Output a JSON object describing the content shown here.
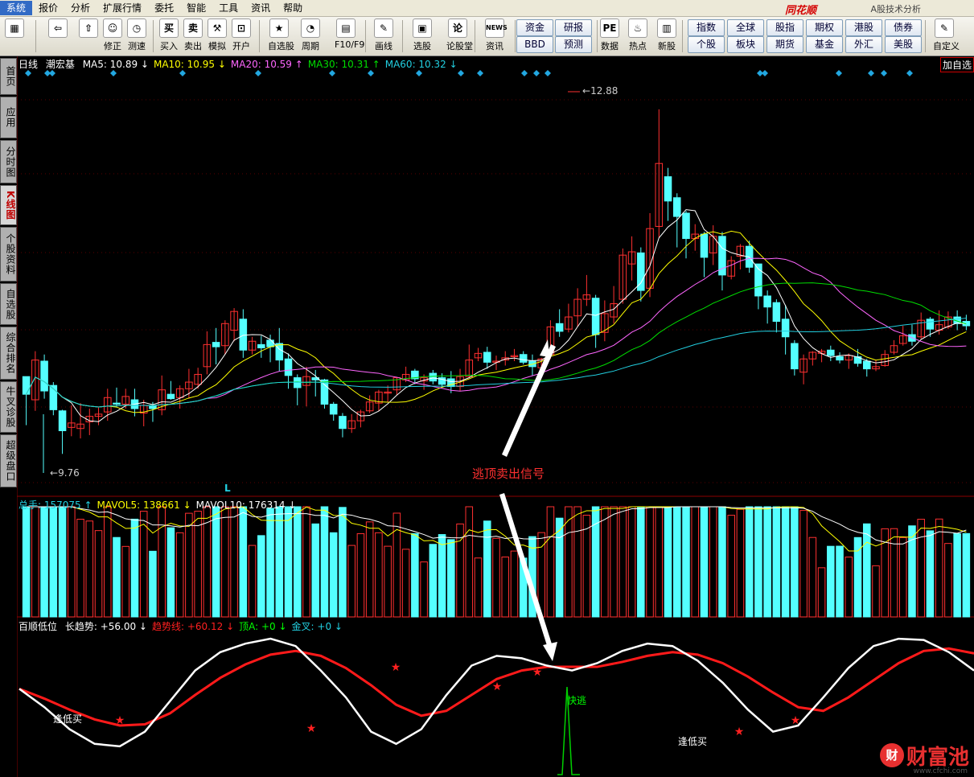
{
  "menu": [
    "系统",
    "报价",
    "分析",
    "扩展行情",
    "委托",
    "智能",
    "工具",
    "资讯",
    "帮助"
  ],
  "brand": {
    "name": "同花顺",
    "subtitle": "A股技术分析"
  },
  "toolbar": {
    "buttons": [
      {
        "label": "",
        "icon": "layout-icon",
        "glyph": "▦"
      },
      {
        "label": "",
        "icon": "back-icon",
        "glyph": "⇦"
      },
      {
        "label": "",
        "icon": "up-down-icon",
        "glyph": "⇧"
      },
      {
        "label": "修正",
        "icon": "adjust-icon",
        "glyph": "☺"
      },
      {
        "label": "测速",
        "icon": "speed-icon",
        "glyph": "◷"
      },
      {
        "label": "买入",
        "icon": "buy-icon",
        "glyph": "买"
      },
      {
        "label": "卖出",
        "icon": "sell-icon",
        "glyph": "卖"
      },
      {
        "label": "模拟",
        "icon": "hammer-icon",
        "glyph": "⚒"
      },
      {
        "label": "开户",
        "icon": "lock-icon",
        "glyph": "⊡"
      },
      {
        "label": "自选股",
        "icon": "star-icon",
        "glyph": "★"
      },
      {
        "label": "周期",
        "icon": "clock-icon",
        "glyph": "◔"
      },
      {
        "label": "F10/F9",
        "icon": "f10-icon",
        "glyph": "▤"
      },
      {
        "label": "画线",
        "icon": "pen-icon",
        "glyph": "✎"
      },
      {
        "label": "选股",
        "icon": "monitor-icon",
        "glyph": "▣"
      },
      {
        "label": "论股堂",
        "icon": "forum-icon",
        "glyph": "论"
      },
      {
        "label": "资讯",
        "icon": "news-icon",
        "glyph": "NEWS"
      },
      {
        "label": "数据",
        "icon": "pe-icon",
        "glyph": "PE"
      },
      {
        "label": "热点",
        "icon": "hot-icon",
        "glyph": "♨"
      },
      {
        "label": "新股",
        "icon": "newstock-icon",
        "glyph": "▥"
      },
      {
        "label": "自定义",
        "icon": "custom-icon",
        "glyph": "✎"
      }
    ],
    "grid_buttons": [
      [
        "资金",
        "研报"
      ],
      [
        "BBD",
        "预测"
      ],
      [
        "指数",
        "全球",
        "股指",
        "期权",
        "港股",
        "债券"
      ],
      [
        "个股",
        "板块",
        "期货",
        "基金",
        "外汇",
        "美股"
      ]
    ]
  },
  "sidebar_tabs": [
    "首页",
    "应用",
    "分时图",
    "K线图",
    "个股资料",
    "自选股",
    "综合排名",
    "牛叉诊股",
    "超级盘口"
  ],
  "sidebar_active": "K线图",
  "price_panel": {
    "period": "日线",
    "stock": "潮宏基",
    "ma": [
      {
        "name": "MA5",
        "value": "10.89",
        "dir": "↓",
        "color": "#ffffff"
      },
      {
        "name": "MA10",
        "value": "10.95",
        "dir": "↓",
        "color": "#ffff00"
      },
      {
        "name": "MA20",
        "value": "10.59",
        "dir": "↑",
        "color": "#ff66ff"
      },
      {
        "name": "MA30",
        "value": "10.31",
        "dir": "↑",
        "color": "#00dd00"
      },
      {
        "name": "MA60",
        "value": "10.32",
        "dir": "↓",
        "color": "#22cfe0"
      }
    ],
    "high_label": "12.88",
    "low_label": "9.76",
    "marker_L": "L",
    "add_button": "加自选"
  },
  "annotation": "逃顶卖出信号",
  "volume_panel": {
    "items": [
      {
        "name": "总手",
        "value": "157075",
        "dir": "↑",
        "color": "#22cfe0"
      },
      {
        "name": "MAVOL5",
        "value": "138661",
        "dir": "↓",
        "color": "#ffff00"
      },
      {
        "name": "MAVOL10",
        "value": "176314",
        "dir": "↓",
        "color": "#ffffff"
      }
    ]
  },
  "indicator_panel": {
    "title": "百顺低位",
    "items": [
      {
        "name": "长趋势",
        "value": "+56.00",
        "dir": "↓",
        "color": "#ffffff"
      },
      {
        "name": "趋势线",
        "value": "+60.12",
        "dir": "↓",
        "color": "#ff2020"
      },
      {
        "name": "顶A",
        "value": "+0",
        "dir": "↓",
        "color": "#00ff00"
      },
      {
        "name": "金叉",
        "value": "+0",
        "dir": "↓",
        "color": "#22cfe0"
      }
    ],
    "labels": [
      "逢低买",
      "快逃",
      "逢低买"
    ]
  },
  "watermark": {
    "logo": "财",
    "text": "财富池",
    "url": "www.cfchi.com"
  },
  "chart_data": {
    "type": "candlestick",
    "price_range": [
      9.5,
      13.2
    ],
    "high": 12.88,
    "low": 9.76,
    "candles": [
      [
        10.46,
        10.3,
        10.46,
        10.02
      ],
      [
        10.25,
        10.61,
        10.69,
        10.15
      ],
      [
        10.6,
        10.33,
        10.66,
        10.26
      ],
      [
        10.38,
        10.16,
        10.41,
        10.11
      ],
      [
        10.15,
        9.97,
        10.16,
        9.76
      ],
      [
        10.0,
        10.04,
        10.2,
        9.92
      ],
      [
        9.99,
        10.03,
        10.22,
        9.9
      ],
      [
        10.05,
        10.1,
        10.17,
        9.93
      ],
      [
        10.1,
        10.12,
        10.18,
        10.02
      ],
      [
        10.14,
        10.27,
        10.35,
        10.06
      ],
      [
        10.22,
        10.21,
        10.36,
        10.18
      ],
      [
        10.21,
        10.28,
        10.35,
        10.17
      ],
      [
        10.25,
        10.17,
        10.35,
        10.1
      ],
      [
        10.13,
        10.2,
        10.25,
        10.01
      ],
      [
        10.2,
        10.17,
        10.23,
        10.05
      ],
      [
        10.16,
        10.34,
        10.47,
        10.11
      ],
      [
        10.3,
        10.26,
        10.42,
        10.25
      ],
      [
        10.27,
        10.35,
        10.38,
        10.17
      ],
      [
        10.35,
        10.41,
        10.53,
        10.26
      ],
      [
        10.39,
        10.48,
        10.54,
        10.35
      ],
      [
        10.55,
        10.75,
        10.87,
        10.48
      ],
      [
        10.77,
        10.73,
        10.9,
        10.57
      ],
      [
        10.74,
        10.94,
        10.97,
        10.66
      ],
      [
        10.88,
        11.05,
        11.08,
        10.78
      ],
      [
        10.98,
        10.7,
        11.07,
        10.63
      ],
      [
        10.7,
        10.78,
        10.82,
        10.66
      ],
      [
        10.75,
        10.72,
        10.83,
        10.63
      ],
      [
        10.79,
        10.73,
        10.84,
        10.59
      ],
      [
        10.76,
        10.61,
        10.9,
        10.51
      ],
      [
        10.62,
        10.47,
        10.67,
        10.35
      ],
      [
        10.45,
        10.36,
        10.48,
        10.2
      ],
      [
        10.38,
        10.46,
        10.55,
        10.19
      ],
      [
        10.45,
        10.43,
        10.52,
        10.28
      ],
      [
        10.43,
        10.21,
        10.44,
        10.17
      ],
      [
        10.21,
        10.12,
        10.23,
        10.06
      ],
      [
        10.1,
        9.99,
        10.13,
        9.91
      ],
      [
        9.99,
        10.06,
        10.12,
        9.95
      ],
      [
        10.06,
        10.14,
        10.16,
        10.0
      ],
      [
        10.15,
        10.23,
        10.29,
        10.13
      ],
      [
        10.22,
        10.32,
        10.34,
        10.15
      ],
      [
        10.31,
        10.32,
        10.38,
        10.23
      ],
      [
        10.34,
        10.45,
        10.45,
        10.29
      ],
      [
        10.43,
        10.48,
        10.55,
        10.41
      ],
      [
        10.51,
        10.44,
        10.53,
        10.39
      ],
      [
        10.42,
        10.45,
        10.48,
        10.34
      ],
      [
        10.49,
        10.42,
        10.52,
        10.39
      ],
      [
        10.45,
        10.39,
        10.49,
        10.36
      ],
      [
        10.44,
        10.37,
        10.51,
        10.31
      ],
      [
        10.37,
        10.46,
        10.53,
        10.33
      ],
      [
        10.46,
        10.61,
        10.75,
        10.45
      ],
      [
        10.63,
        10.67,
        10.72,
        10.6
      ],
      [
        10.68,
        10.59,
        10.73,
        10.53
      ],
      [
        10.59,
        10.6,
        10.65,
        10.52
      ],
      [
        10.61,
        10.63,
        10.69,
        10.56
      ],
      [
        10.64,
        10.65,
        10.71,
        10.6
      ],
      [
        10.66,
        10.59,
        10.69,
        10.57
      ],
      [
        10.6,
        10.55,
        10.66,
        10.47
      ],
      [
        10.54,
        10.62,
        10.63,
        10.51
      ],
      [
        10.66,
        10.91,
        10.97,
        10.62
      ],
      [
        10.94,
        10.87,
        11.07,
        10.82
      ],
      [
        10.89,
        11.0,
        11.12,
        10.86
      ],
      [
        11.01,
        11.16,
        11.26,
        10.91
      ],
      [
        11.16,
        11.2,
        11.38,
        11.1
      ],
      [
        11.17,
        10.84,
        11.2,
        10.72
      ],
      [
        10.86,
        11.03,
        11.15,
        10.78
      ],
      [
        11.0,
        11.12,
        11.28,
        10.94
      ],
      [
        11.16,
        11.56,
        11.62,
        11.12
      ],
      [
        11.48,
        11.59,
        11.73,
        11.33
      ],
      [
        11.58,
        11.24,
        11.63,
        11.14
      ],
      [
        11.26,
        11.8,
        11.94,
        11.18
      ],
      [
        11.82,
        12.39,
        12.88,
        11.72
      ],
      [
        12.27,
        12.05,
        12.35,
        11.87
      ],
      [
        12.08,
        11.91,
        12.12,
        11.63
      ],
      [
        11.94,
        11.71,
        11.96,
        11.53
      ],
      [
        11.71,
        11.75,
        11.84,
        11.6
      ],
      [
        11.75,
        11.54,
        11.77,
        11.36
      ],
      [
        11.58,
        11.73,
        11.83,
        11.47
      ],
      [
        11.73,
        11.38,
        11.77,
        11.24
      ],
      [
        11.37,
        11.51,
        11.55,
        11.34
      ],
      [
        11.55,
        11.64,
        11.66,
        11.43
      ],
      [
        11.64,
        11.45,
        11.69,
        11.4
      ],
      [
        11.48,
        11.19,
        11.48,
        11.07
      ],
      [
        11.19,
        11.09,
        11.24,
        10.94
      ],
      [
        11.13,
        10.96,
        11.16,
        10.86
      ],
      [
        10.98,
        10.82,
        11.11,
        10.66
      ],
      [
        10.76,
        10.53,
        10.79,
        10.47
      ],
      [
        10.5,
        10.62,
        10.66,
        10.39
      ],
      [
        10.62,
        10.68,
        10.69,
        10.56
      ],
      [
        10.67,
        10.69,
        10.71,
        10.59
      ],
      [
        10.7,
        10.65,
        10.74,
        10.6
      ],
      [
        10.64,
        10.61,
        10.68,
        10.58
      ],
      [
        10.61,
        10.65,
        10.67,
        10.53
      ],
      [
        10.64,
        10.58,
        10.71,
        10.55
      ],
      [
        10.6,
        10.53,
        10.62,
        10.46
      ],
      [
        10.53,
        10.55,
        10.61,
        10.51
      ],
      [
        10.56,
        10.66,
        10.7,
        10.55
      ],
      [
        10.68,
        10.74,
        10.79,
        10.66
      ],
      [
        10.76,
        10.83,
        10.92,
        10.74
      ],
      [
        10.84,
        10.78,
        10.93,
        10.74
      ],
      [
        10.82,
        10.97,
        11.04,
        10.8
      ],
      [
        10.98,
        10.89,
        11.0,
        10.82
      ],
      [
        10.88,
        10.93,
        11.06,
        10.84
      ],
      [
        10.91,
        11.0,
        11.05,
        10.89
      ],
      [
        11.0,
        10.94,
        11.06,
        10.88
      ],
      [
        10.96,
        10.92,
        11.02,
        10.88
      ]
    ],
    "ma_series": [
      "MA5",
      "MA10",
      "MA20",
      "MA30",
      "MA60"
    ],
    "indicator_long_trend": [
      55,
      40,
      22,
      10,
      8,
      20,
      45,
      70,
      85,
      92,
      96,
      90,
      70,
      48,
      20,
      10,
      22,
      50,
      74,
      82,
      80,
      74,
      70,
      76,
      86,
      92,
      90,
      78,
      60,
      38,
      20,
      25,
      48,
      72,
      90,
      96,
      95,
      85,
      70
    ],
    "indicator_trend_line": [
      55,
      47,
      38,
      30,
      25,
      26,
      35,
      50,
      64,
      75,
      83,
      86,
      82,
      72,
      58,
      42,
      33,
      37,
      50,
      63,
      70,
      73,
      73,
      73,
      77,
      82,
      85,
      83,
      76,
      65,
      52,
      40,
      37,
      48,
      62,
      76,
      86,
      88,
      84
    ]
  }
}
